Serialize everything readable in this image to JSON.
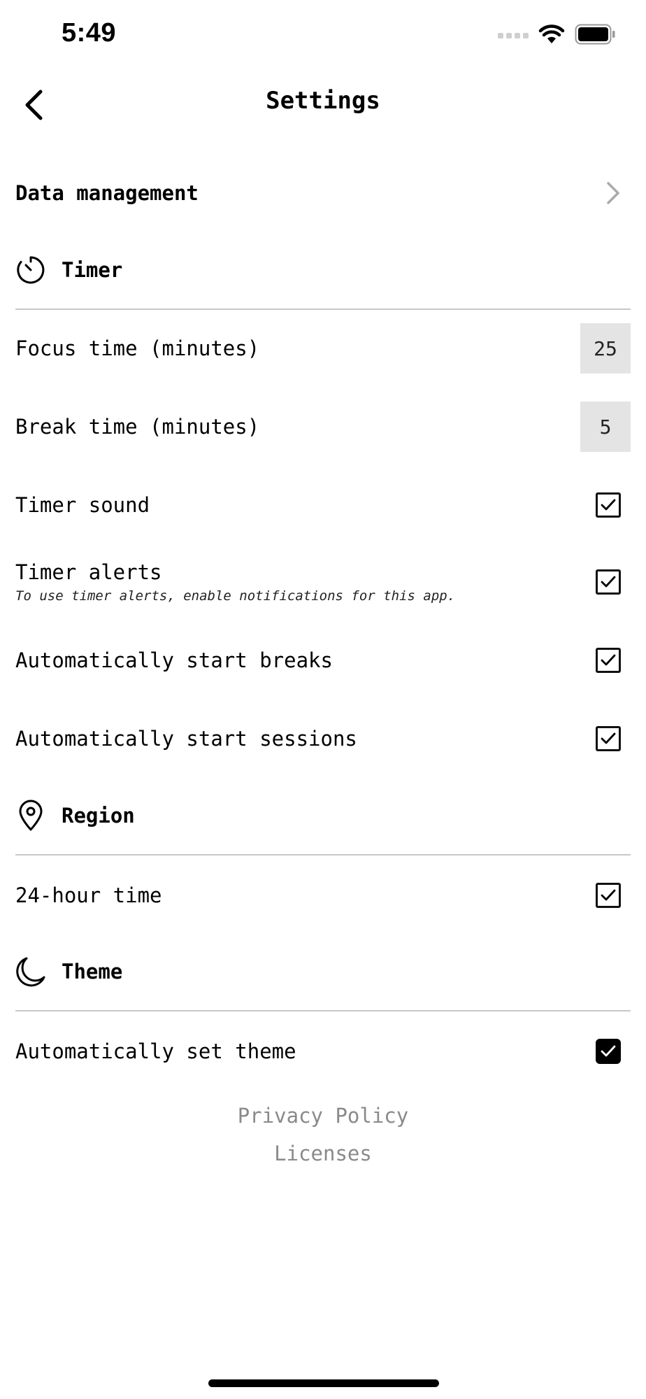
{
  "status_bar": {
    "time": "5:49"
  },
  "nav": {
    "title": "Settings"
  },
  "data_management": {
    "label": "Data management"
  },
  "timer_section": {
    "title": "Timer",
    "focus_time": {
      "label": "Focus time (minutes)",
      "value": "25"
    },
    "break_time": {
      "label": "Break time (minutes)",
      "value": "5"
    },
    "timer_sound": {
      "label": "Timer sound",
      "checked": true
    },
    "timer_alerts": {
      "label": "Timer alerts",
      "subtext": "To use timer alerts, enable notifications for this app.",
      "checked": true
    },
    "auto_start_breaks": {
      "label": "Automatically start breaks",
      "checked": true
    },
    "auto_start_sessions": {
      "label": "Automatically start sessions",
      "checked": true
    }
  },
  "region_section": {
    "title": "Region",
    "hour24": {
      "label": "24-hour time",
      "checked": true
    }
  },
  "theme_section": {
    "title": "Theme",
    "auto_theme": {
      "label": "Automatically set theme",
      "checked": true,
      "style": "filled"
    }
  },
  "footer": {
    "privacy_policy": "Privacy Policy",
    "licenses": "Licenses"
  },
  "colors": {
    "divider": "#c8c8c8",
    "number_box": "#e4e4e4",
    "footer_link": "#8a8a8a"
  }
}
